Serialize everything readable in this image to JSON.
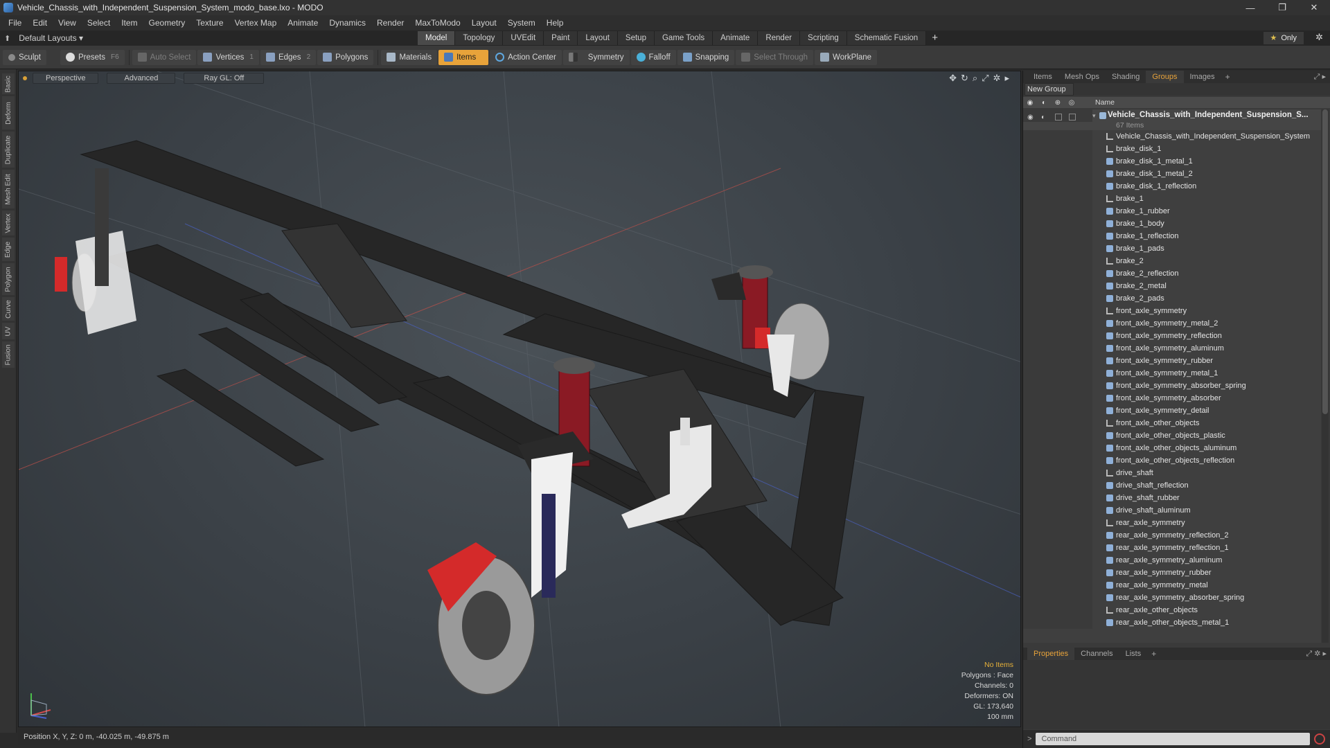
{
  "window": {
    "title": "Vehicle_Chassis_with_Independent_Suspension_System_modo_base.lxo - MODO",
    "controls": [
      "—",
      "❐",
      "✕"
    ]
  },
  "menu": [
    "File",
    "Edit",
    "View",
    "Select",
    "Item",
    "Geometry",
    "Texture",
    "Vertex Map",
    "Animate",
    "Dynamics",
    "Render",
    "MaxToModo",
    "Layout",
    "System",
    "Help"
  ],
  "layoutbar": {
    "layout_label": "Default Layouts ▾",
    "tabs": [
      "Model",
      "Topology",
      "UVEdit",
      "Paint",
      "Layout",
      "Setup",
      "Game Tools",
      "Animate",
      "Render",
      "Scripting",
      "Schematic Fusion"
    ],
    "active_tab": "Model",
    "add_tab": "+",
    "only_label": "Only",
    "only_star": "★"
  },
  "toolbar": {
    "sculpt": "Sculpt",
    "presets": "Presets",
    "presets_key": "F6",
    "auto_select": "Auto Select",
    "vertices": "Vertices",
    "vertices_count": "1",
    "edges": "Edges",
    "edges_count": "2",
    "polygons": "Polygons",
    "materials": "Materials",
    "items": "Items",
    "action_center": "Action Center",
    "symmetry": "Symmetry",
    "falloff": "Falloff",
    "snapping": "Snapping",
    "select_through": "Select Through",
    "workplane": "WorkPlane"
  },
  "left_tabs": [
    "Basic",
    "Deform",
    "Duplicate",
    "Mesh Edit",
    "Vertex",
    "Edge",
    "Polygon",
    "Curve",
    "UV",
    "Fusion"
  ],
  "viewport": {
    "view_mode": "Perspective",
    "shading": "Advanced",
    "raygl": "Ray GL: Off",
    "info": {
      "selection": "No Items",
      "polygons": "Polygons : Face",
      "channels": "Channels: 0",
      "deformers": "Deformers: ON",
      "gl": "GL: 173,640",
      "scale": "100 mm"
    }
  },
  "statusbar": {
    "position": "Position X, Y, Z:   0 m, -40.025 m, -49.875 m"
  },
  "right_panel": {
    "tabs": [
      "Items",
      "Mesh Ops",
      "Shading",
      "Groups",
      "Images"
    ],
    "active_tab": "Groups",
    "new_group": "New Group",
    "column_name": "Name",
    "group": {
      "name": "Vehicle_Chassis_with_Independent_Suspension_S...",
      "count": "67 Items"
    },
    "items": [
      {
        "name": "Vehicle_Chassis_with_Independent_Suspension_System",
        "icon": "locator-icon"
      },
      {
        "name": "brake_disk_1",
        "icon": "locator-icon"
      },
      {
        "name": "brake_disk_1_metal_1",
        "icon": "mesh-icon"
      },
      {
        "name": "brake_disk_1_metal_2",
        "icon": "mesh-icon"
      },
      {
        "name": "brake_disk_1_reflection",
        "icon": "mesh-icon"
      },
      {
        "name": "brake_1",
        "icon": "locator-icon"
      },
      {
        "name": "brake_1_rubber",
        "icon": "mesh-icon"
      },
      {
        "name": "brake_1_body",
        "icon": "mesh-icon"
      },
      {
        "name": "brake_1_reflection",
        "icon": "mesh-icon"
      },
      {
        "name": "brake_1_pads",
        "icon": "mesh-icon"
      },
      {
        "name": "brake_2",
        "icon": "locator-icon"
      },
      {
        "name": "brake_2_reflection",
        "icon": "mesh-icon"
      },
      {
        "name": "brake_2_metal",
        "icon": "mesh-icon"
      },
      {
        "name": "brake_2_pads",
        "icon": "mesh-icon"
      },
      {
        "name": "front_axle_symmetry",
        "icon": "locator-icon"
      },
      {
        "name": "front_axle_symmetry_metal_2",
        "icon": "mesh-icon"
      },
      {
        "name": "front_axle_symmetry_reflection",
        "icon": "mesh-icon"
      },
      {
        "name": "front_axle_symmetry_aluminum",
        "icon": "mesh-icon"
      },
      {
        "name": "front_axle_symmetry_rubber",
        "icon": "mesh-icon"
      },
      {
        "name": "front_axle_symmetry_metal_1",
        "icon": "mesh-icon"
      },
      {
        "name": "front_axle_symmetry_absorber_spring",
        "icon": "mesh-icon"
      },
      {
        "name": "front_axle_symmetry_absorber",
        "icon": "mesh-icon"
      },
      {
        "name": "front_axle_symmetry_detail",
        "icon": "mesh-icon"
      },
      {
        "name": "front_axle_other_objects",
        "icon": "locator-icon"
      },
      {
        "name": "front_axle_other_objects_plastic",
        "icon": "mesh-icon"
      },
      {
        "name": "front_axle_other_objects_aluminum",
        "icon": "mesh-icon"
      },
      {
        "name": "front_axle_other_objects_reflection",
        "icon": "mesh-icon"
      },
      {
        "name": "drive_shaft",
        "icon": "locator-icon"
      },
      {
        "name": "drive_shaft_reflection",
        "icon": "mesh-icon"
      },
      {
        "name": "drive_shaft_rubber",
        "icon": "mesh-icon"
      },
      {
        "name": "drive_shaft_aluminum",
        "icon": "mesh-icon"
      },
      {
        "name": "rear_axle_symmetry",
        "icon": "locator-icon"
      },
      {
        "name": "rear_axle_symmetry_reflection_2",
        "icon": "mesh-icon"
      },
      {
        "name": "rear_axle_symmetry_reflection_1",
        "icon": "mesh-icon"
      },
      {
        "name": "rear_axle_symmetry_aluminum",
        "icon": "mesh-icon"
      },
      {
        "name": "rear_axle_symmetry_rubber",
        "icon": "mesh-icon"
      },
      {
        "name": "rear_axle_symmetry_metal",
        "icon": "mesh-icon"
      },
      {
        "name": "rear_axle_symmetry_absorber_spring",
        "icon": "mesh-icon"
      },
      {
        "name": "rear_axle_other_objects",
        "icon": "locator-icon"
      },
      {
        "name": "rear_axle_other_objects_metal_1",
        "icon": "mesh-icon"
      }
    ],
    "bottom_tabs": [
      "Properties",
      "Channels",
      "Lists"
    ],
    "bottom_active": "Properties",
    "command_placeholder": "Command"
  },
  "colors": {
    "accent": "#e8a33a",
    "brake_red": "#d42a2a",
    "spring_red": "#8a1a24",
    "frame": "#2a2a2a",
    "white_part": "#e8e8e8"
  }
}
